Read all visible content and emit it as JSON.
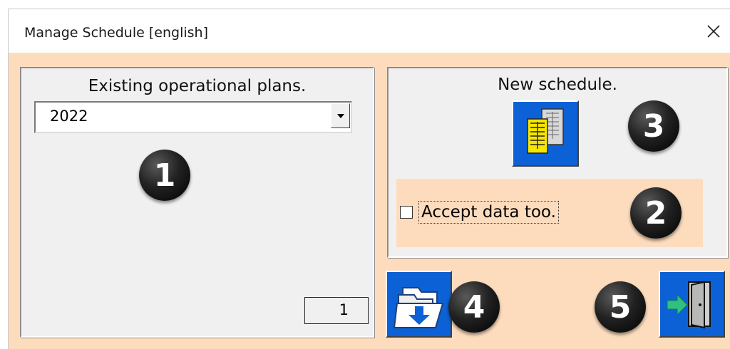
{
  "window": {
    "title": "Manage Schedule [english]",
    "close_icon": "close-icon"
  },
  "left_panel": {
    "title": "Existing operational plans.",
    "year_select": {
      "selected": "2022",
      "icon": "chevron-down-icon"
    },
    "badge": "1",
    "count": "1"
  },
  "right_panel": {
    "title": "New schedule.",
    "new_button_icon": "new-schedule-icon",
    "badge_new": "3",
    "accept_data": {
      "label": "Accept data too.",
      "checked": false
    },
    "badge_accept": "2"
  },
  "bottom": {
    "open_button_icon": "open-folder-icon",
    "badge_open": "4",
    "badge_exit": "5",
    "exit_button_icon": "exit-door-icon"
  },
  "colors": {
    "dialog_bg": "#fddcbe",
    "panel_bg": "#f0f0f0",
    "button_blue": "#0c61d6",
    "arrow_green": "#2ec27e",
    "icon_yellow": "#f5e500"
  }
}
